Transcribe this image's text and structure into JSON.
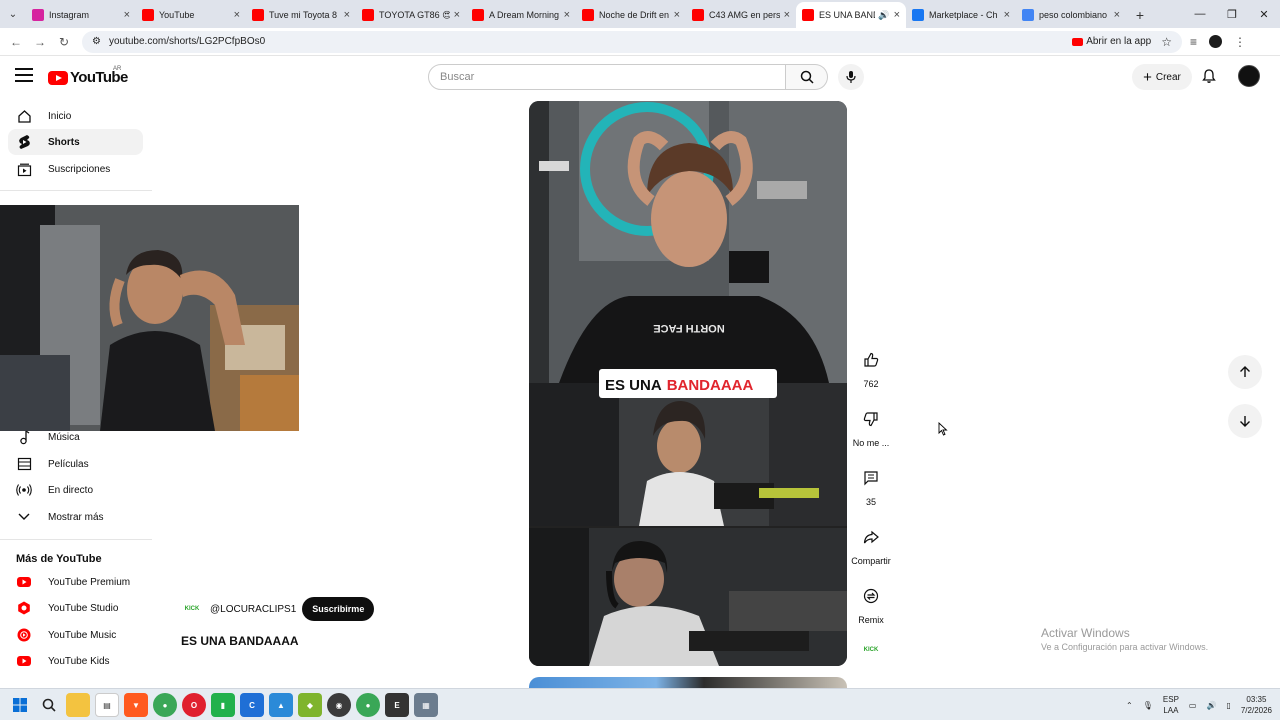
{
  "browser": {
    "tabs": [
      {
        "title": "Instagram",
        "favicon": "instagram-icon",
        "color": "#d6249f"
      },
      {
        "title": "YouTube",
        "favicon": "youtube-icon",
        "color": "#ff0000"
      },
      {
        "title": "Tuve mi Toyota 8",
        "favicon": "youtube-icon",
        "color": "#ff0000"
      },
      {
        "title": "TOYOTA GT86 😍",
        "favicon": "youtube-icon",
        "color": "#ff0000"
      },
      {
        "title": "A Dream Morning",
        "favicon": "youtube-icon",
        "color": "#ff0000"
      },
      {
        "title": "Noche de Drift en",
        "favicon": "youtube-icon",
        "color": "#ff0000"
      },
      {
        "title": "C43 AMG en pers",
        "favicon": "youtube-icon",
        "color": "#ff0000"
      },
      {
        "title": "ES UNA BAND",
        "favicon": "youtube-icon",
        "color": "#ff0000",
        "active": true
      },
      {
        "title": "Marketplace - Ch",
        "favicon": "facebook-icon",
        "color": "#1877f2"
      },
      {
        "title": "peso colombiano",
        "favicon": "google-icon",
        "color": "#4285f4"
      }
    ],
    "url": "youtube.com/shorts/LG2PCfpBOs0",
    "open_app": "Abrir en la app"
  },
  "masthead": {
    "logo": "YouTube",
    "country": "AR",
    "search_placeholder": "Buscar",
    "create": "Crear"
  },
  "sidebar": {
    "items": [
      {
        "label": "Inicio",
        "icon": "home-icon"
      },
      {
        "label": "Shorts",
        "icon": "shorts-icon"
      },
      {
        "label": "Suscripciones",
        "icon": "subscriptions-icon"
      }
    ],
    "explore": [
      {
        "label": "Música",
        "icon": "music-icon"
      },
      {
        "label": "Películas",
        "icon": "movies-icon"
      },
      {
        "label": "En directo",
        "icon": "live-icon"
      },
      {
        "label": "Mostrar más",
        "icon": "chevron-down-icon"
      }
    ],
    "more_heading": "Más de YouTube",
    "more": [
      {
        "label": "YouTube Premium"
      },
      {
        "label": "YouTube Studio"
      },
      {
        "label": "YouTube Music"
      },
      {
        "label": "YouTube Kids"
      }
    ]
  },
  "short": {
    "channel": "@LOCURACLIPS1",
    "channel_logo": "KICK",
    "subscribe": "Suscribirme",
    "title": "ES UNA BANDAAAA",
    "caption_white": "ES UNA",
    "caption_red": "BANDAAAA",
    "shirt_text": "NORTH FACE"
  },
  "actions": {
    "likes": "762",
    "dislike": "No me ...",
    "comments": "35",
    "share": "Compartir",
    "remix": "Remix",
    "audio_logo": "KICK"
  },
  "watermark": {
    "line1": "Activar Windows",
    "line2": "Ve a Configuración para activar Windows."
  },
  "taskbar": {
    "lang1": "ESP",
    "lang2": "LAA",
    "time": "03:35",
    "date": "7/2/2026"
  }
}
